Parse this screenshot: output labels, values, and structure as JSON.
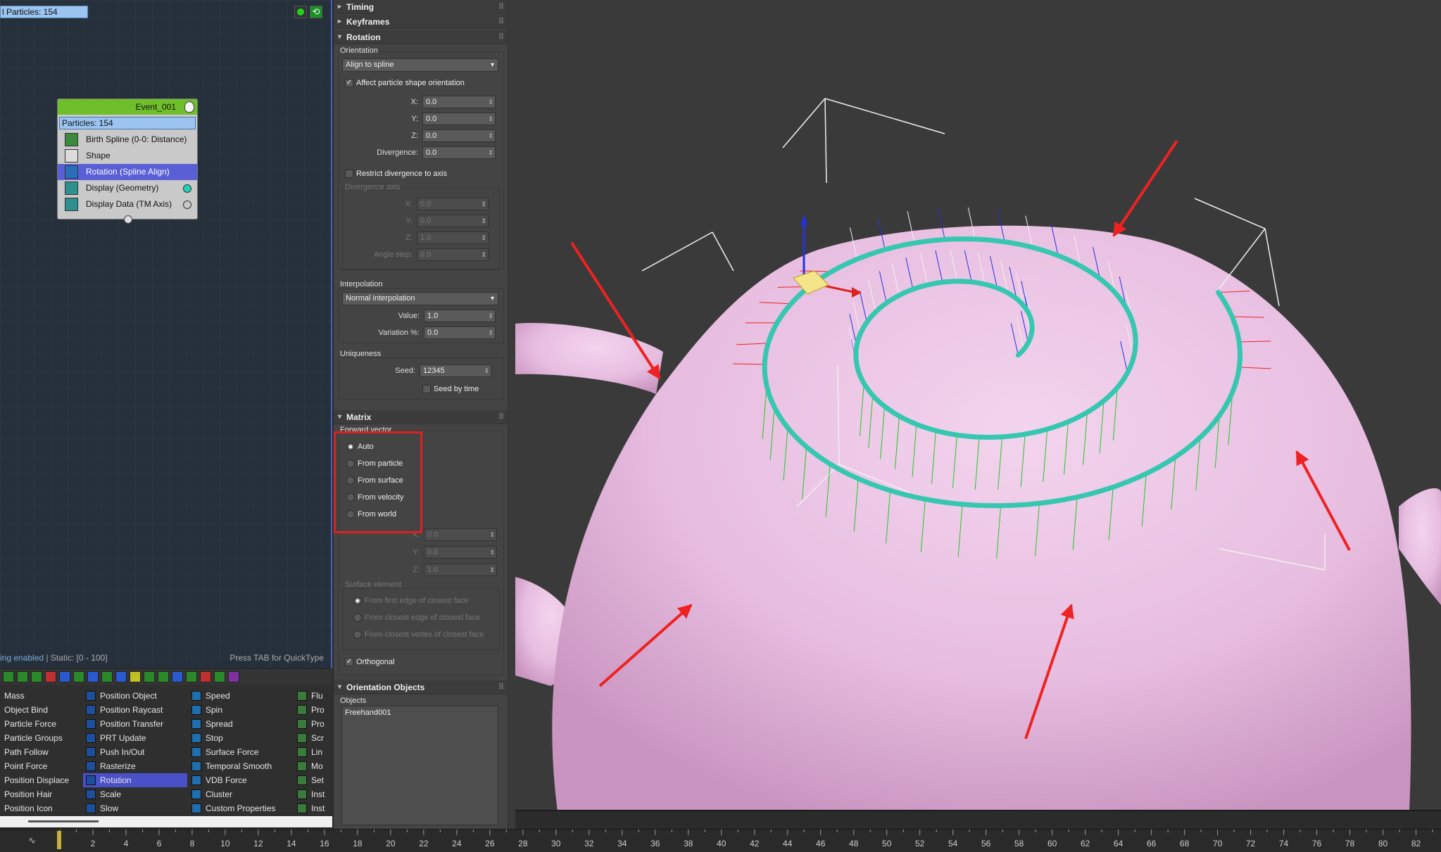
{
  "node_editor": {
    "root_header": "l Particles: 154",
    "event": {
      "title": "Event_001",
      "particles": "Particles: 154",
      "operators": [
        {
          "label": "Birth Spline (0-0: Distance)",
          "icon_color": "#3c8a3c"
        },
        {
          "label": "Shape",
          "icon_color": "#dcdcdc"
        },
        {
          "label": "Rotation (Spline Align)",
          "icon_color": "#2b6fb8"
        },
        {
          "label": "Display (Geometry)",
          "icon_color": "#2f9090",
          "dot_color": "#21d4b8"
        },
        {
          "label": "Display Data (TM Axis)",
          "icon_color": "#2f9090",
          "dot_color": "#c9c9c9"
        }
      ]
    },
    "status_left": "ing enabled",
    "status_left_dim": " | Static: [0 - 100]",
    "status_right": "Press TAB for QuickType"
  },
  "depot": {
    "toolbar_colors": [
      "#2a8a2a",
      "#2a8a2a",
      "#2a8a2a",
      "#c03030",
      "#2a5ad0",
      "#2a8a2a",
      "#2a5ad0",
      "#2a8a2a",
      "#2a5ad0",
      "#c0c020",
      "#2a8a2a",
      "#2a8a2a",
      "#2a5ad0",
      "#2a8a2a",
      "#c03030",
      "#2a8a2a",
      "#8030a0"
    ],
    "columns": [
      {
        "items": [
          {
            "label": "Mass"
          },
          {
            "label": "Object Bind"
          },
          {
            "label": "Particle Force"
          },
          {
            "label": "Particle Groups"
          },
          {
            "label": "Path Follow"
          },
          {
            "label": "Point Force"
          },
          {
            "label": "Position Displace"
          },
          {
            "label": "Position Hair"
          },
          {
            "label": "Position Icon"
          }
        ]
      },
      {
        "items": [
          {
            "label": "Position Object"
          },
          {
            "label": "Position Raycast"
          },
          {
            "label": "Position Transfer"
          },
          {
            "label": "PRT Update"
          },
          {
            "label": "Push In/Out"
          },
          {
            "label": "Rasterize"
          },
          {
            "label": "Rotation",
            "selected": true
          },
          {
            "label": "Scale"
          },
          {
            "label": "Slow"
          }
        ]
      },
      {
        "items": [
          {
            "label": "Speed"
          },
          {
            "label": "Spin"
          },
          {
            "label": "Spread"
          },
          {
            "label": "Stop"
          },
          {
            "label": "Surface Force"
          },
          {
            "label": "Temporal Smooth"
          },
          {
            "label": "VDB Force"
          },
          {
            "label": "Cluster"
          },
          {
            "label": "Custom Properties"
          }
        ]
      },
      {
        "items": [
          {
            "label": "Flu"
          },
          {
            "label": "Pro"
          },
          {
            "label": "Pro"
          },
          {
            "label": "Scr"
          },
          {
            "label": "Lin"
          },
          {
            "label": "Mo"
          },
          {
            "label": "Set"
          },
          {
            "label": "Inst"
          },
          {
            "label": "Inst"
          }
        ]
      }
    ]
  },
  "props": {
    "rollouts": {
      "timing": "Timing",
      "keyframes": "Keyframes",
      "rotation": "Rotation",
      "matrix": "Matrix",
      "orientation_objects": "Orientation Objects"
    },
    "orientation_label": "Orientation",
    "orientation_value": "Align to spline",
    "affect_shape": "Affect particle shape orientation",
    "x_label": "X:",
    "x_value": "0.0",
    "y_label": "Y:",
    "y_value": "0.0",
    "z_label": "Z:",
    "z_value": "0.0",
    "divergence_label": "Divergence:",
    "divergence_value": "0.0",
    "restrict_divergence": "Restrict divergence to axis",
    "divergence_axis_label": "Divergence axis",
    "dax_x": "0.0",
    "dax_y": "0.0",
    "dax_z": "1.0",
    "angle_step_label": "Angle step:",
    "angle_step_value": "0.0",
    "interpolation_label": "Interpolation",
    "interpolation_value": "Normal interpolation",
    "value_label": "Value:",
    "value_value": "1.0",
    "variation_label": "Variation %:",
    "variation_value": "0.0",
    "uniqueness_label": "Uniqueness",
    "seed_label": "Seed:",
    "seed_value": "12345",
    "seed_by_time": "Seed by time",
    "forward_vector_label": "Forward vector",
    "radios": [
      "Auto",
      "From particle",
      "From surface",
      "From velocity",
      "From world"
    ],
    "mx_x": "0.0",
    "mx_y": "0.0",
    "mx_z": "1.0",
    "surface_element_label": "Surface element",
    "surface_options": [
      "From first edge of closest face",
      "From closest edge of closest face",
      "From closest vertex of closest face"
    ],
    "orthogonal": "Orthogonal",
    "objects_label": "Objects",
    "objects": [
      "Freehand001"
    ]
  },
  "timeline": {
    "ticks": [
      2,
      4,
      6,
      8,
      10,
      12,
      14,
      16,
      18,
      20,
      22,
      24,
      26,
      28,
      30,
      32,
      34,
      36,
      38,
      40,
      42,
      44,
      46,
      48,
      50,
      52,
      54,
      56,
      58,
      60,
      62,
      64,
      66,
      68,
      70,
      72,
      74,
      76,
      78,
      80,
      82
    ]
  },
  "viewport": {
    "teapot_color": "#e7bde0",
    "arrow_color": "#ee2222",
    "spiral_color": "#36c7b0"
  }
}
